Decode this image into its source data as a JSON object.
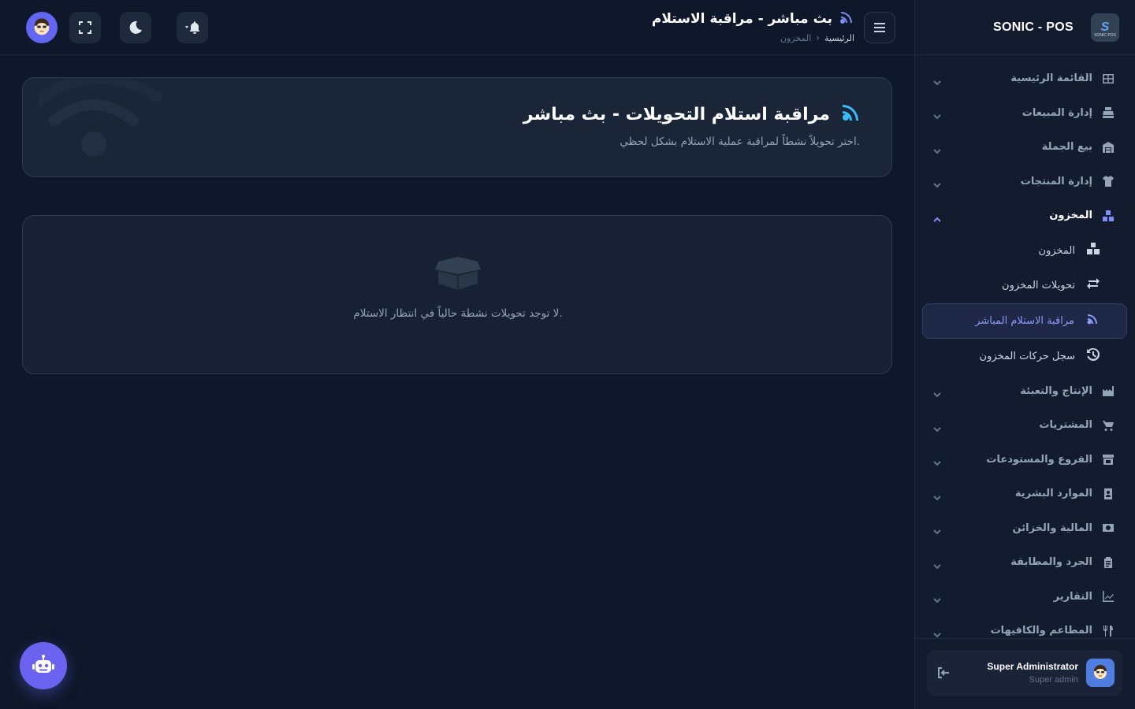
{
  "brand": {
    "name": "SONIC - POS",
    "logo_letter": "S",
    "logo_tag": "SONIC POS"
  },
  "topbar": {
    "title": "بث مباشر - مراقبة الاستلام",
    "breadcrumb_home": "الرئيسية",
    "breadcrumb_separator": "›",
    "breadcrumb_current": "المخزون"
  },
  "sidebar": {
    "items": [
      {
        "label": "القائمة الرئيسية",
        "icon": "grid-icon"
      },
      {
        "label": "إدارة المبيعات",
        "icon": "register-icon"
      },
      {
        "label": "بيع الجملة",
        "icon": "warehouse-icon"
      },
      {
        "label": "إدارة المنتجات",
        "icon": "shirt-icon"
      },
      {
        "label": "المخزون",
        "icon": "boxes-icon",
        "expanded": true
      },
      {
        "label": "الإنتاج والتعبئة",
        "icon": "factory-icon"
      },
      {
        "label": "المشتريات",
        "icon": "cart-icon"
      },
      {
        "label": "الفروع والمستودعات",
        "icon": "store-icon"
      },
      {
        "label": "الموارد البشرية",
        "icon": "id-badge-icon"
      },
      {
        "label": "المالية والخزائن",
        "icon": "money-icon"
      },
      {
        "label": "الجرد والمطابقة",
        "icon": "clipboard-icon"
      },
      {
        "label": "التقارير",
        "icon": "chart-icon"
      },
      {
        "label": "المطاعم والكافيهات",
        "icon": "utensils-icon"
      }
    ],
    "inventory_sub": [
      {
        "label": "المخزون",
        "icon": "boxes-icon"
      },
      {
        "label": "تحويلات المخزون",
        "icon": "exchange-icon"
      },
      {
        "label": "مراقبة الاستلام المباشر",
        "icon": "broadcast-icon",
        "active": true
      },
      {
        "label": "سجل حركات المخزون",
        "icon": "history-icon"
      }
    ]
  },
  "user": {
    "name": "Super Administrator",
    "role": "Super admin"
  },
  "hero": {
    "title": "مراقبة استلام التحويلات - بث مباشر",
    "subtitle": "اختر تحويلاً نشطاً لمراقبة عملية الاستلام بشكل لحظي."
  },
  "empty": {
    "message": "لا توجد تحويلات نشطة حالياً في انتظار الاستلام."
  },
  "colors": {
    "accent": "#818cf8",
    "hero_icon": "#38bdf8",
    "background": "#0f172a",
    "fab": "#6b63f0"
  }
}
